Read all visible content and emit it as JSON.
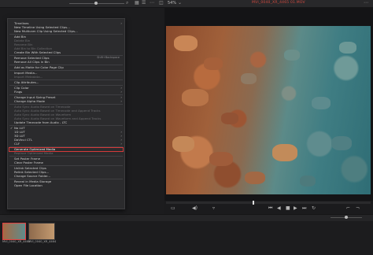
{
  "toolbar": {
    "zoom": "54%",
    "clip_name": "MVI_0040_XR_4465 01.MOV"
  },
  "menu": {
    "items": [
      {
        "label": "Timelines",
        "arrow": true
      },
      {
        "label": "New Timeline Using Selected Clips..."
      },
      {
        "label": "New Multicam Clip Using Selected Clips..."
      },
      {
        "sep": true
      },
      {
        "label": "Add Bin"
      },
      {
        "label": "Delete Bin",
        "disabled": true
      },
      {
        "label": "Rename Bin",
        "disabled": true
      },
      {
        "label": "Add Bin to Bin Collection",
        "disabled": true
      },
      {
        "label": "Create Bin With Selected Clips"
      },
      {
        "sep": true
      },
      {
        "label": "Remove Selected Clips",
        "shortcut": "Shift+Backspace"
      },
      {
        "label": "Remove All Clips in Bin"
      },
      {
        "sep": true
      },
      {
        "label": "Add as Matte for Color Page Clip"
      },
      {
        "sep": true
      },
      {
        "label": "Import Media..."
      },
      {
        "label": "Import Metadata...",
        "disabled": true
      },
      {
        "sep": true
      },
      {
        "label": "Clip Attributes..."
      },
      {
        "sep": true
      },
      {
        "label": "Clip Color",
        "arrow": true
      },
      {
        "label": "Flags",
        "arrow": true
      },
      {
        "sep": true
      },
      {
        "label": "Change Input Sizing Preset",
        "arrow": true
      },
      {
        "label": "Change Alpha Mode",
        "arrow": true
      },
      {
        "sep": true
      },
      {
        "label": "Auto Sync Audio Based on Timecode",
        "disabled": true
      },
      {
        "label": "Auto Sync Audio Based on Timecode and Append Tracks",
        "disabled": true
      },
      {
        "label": "Auto Sync Audio Based on Waveform",
        "disabled": true
      },
      {
        "label": "Auto Sync Audio Based on Waveform and Append Tracks",
        "disabled": true
      },
      {
        "label": "Update Timecode from Audio - LTC"
      },
      {
        "sep": true
      },
      {
        "label": "No LUT",
        "check": true
      },
      {
        "label": "1D LUT",
        "arrow": true
      },
      {
        "label": "3D LUT",
        "arrow": true
      },
      {
        "label": "DaVinci CTL",
        "arrow": true
      },
      {
        "label": "CLF",
        "arrow": true
      },
      {
        "sep": true
      },
      {
        "label": "Generate Optimized Media",
        "highlight": true
      },
      {
        "label": "Replace Optimized Media",
        "disabled": true
      },
      {
        "sep": true
      },
      {
        "label": "Set Poster Frame"
      },
      {
        "label": "Clear Poster Frame"
      },
      {
        "sep": true
      },
      {
        "label": "Unlink Selected Clips"
      },
      {
        "label": "Relink Selected Clips..."
      },
      {
        "label": "Change Source Folder..."
      },
      {
        "sep": true
      },
      {
        "label": "Reveal in Media Storage"
      },
      {
        "label": "Open File Location"
      }
    ]
  },
  "media_pool": {
    "clips": [
      {
        "name": "MVI_0040_XR_4465",
        "selected": true
      },
      {
        "name": "MVI_0040_XR_4464",
        "selected": false
      }
    ]
  },
  "icons": {
    "grid_view": "grid-view-icon",
    "list_view": "list-view-icon",
    "play": "play-icon",
    "stop": "stop-icon",
    "skip_back": "skip-back-icon",
    "skip_forward": "skip-forward-icon",
    "loop": "loop-icon",
    "audio": "speaker-icon"
  },
  "colors": {
    "highlight_border": "#d43a3a",
    "clip_name": "#d04a40",
    "menu_bg": "#2b2b2d"
  }
}
